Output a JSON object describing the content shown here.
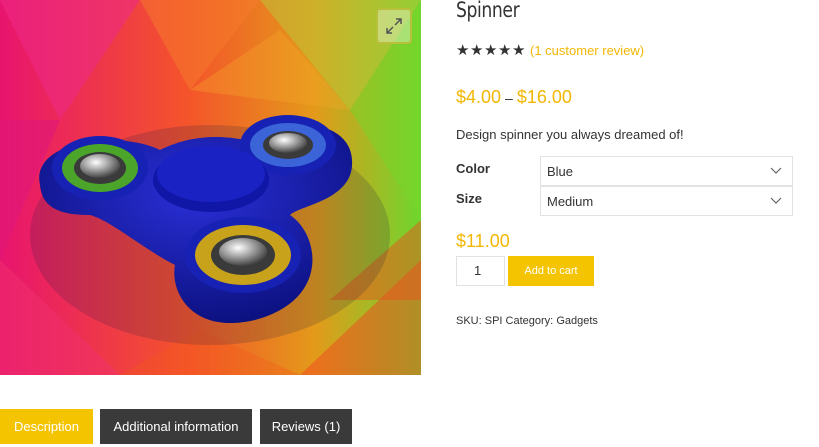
{
  "product": {
    "title": "Spinner",
    "rating": 5,
    "review_link": "(1 customer review)",
    "price_min": "$4.00",
    "price_separator": "–",
    "price_max": "$16.00",
    "short_description": "Design spinner you always dreamed of!",
    "image_alt": "fidget spinner"
  },
  "variations": {
    "color_label": "Color",
    "color_value": "Blue",
    "size_label": "Size",
    "size_value": "Medium"
  },
  "cart": {
    "variation_price": "$11.00",
    "quantity": "1",
    "add_to_cart_label": "Add to cart"
  },
  "meta": {
    "sku_label": "SKU:",
    "sku_value": "SPI",
    "category_label": "Category:",
    "category_value": "Gadgets"
  },
  "tabs": [
    {
      "label": "Description",
      "active": true
    },
    {
      "label": "Additional information",
      "active": false
    },
    {
      "label": "Reviews (1)",
      "active": false
    }
  ],
  "colors": {
    "accent": "#f5c400",
    "price": "#f2b705",
    "tab_inactive": "#3a3a3a",
    "text": "#333333"
  },
  "icons": {
    "zoom": "expand-icon",
    "star": "star-icon",
    "chevron": "chevron-down-icon"
  }
}
